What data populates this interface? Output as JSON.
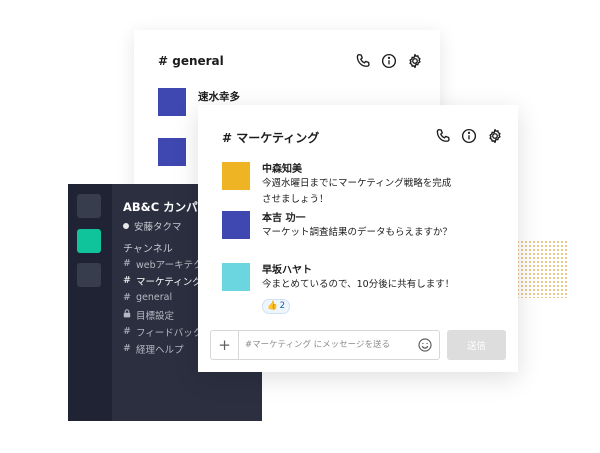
{
  "colors": {
    "sidebar_bg": "#2b2f3f",
    "rail_bg": "#1f2333",
    "active_workspace": "#0fc49b",
    "avatar_blue": "#3f47b0",
    "avatar_yellow": "#efb424",
    "avatar_cyan": "#6cd6e0",
    "send_button_disabled": "#dddddd"
  },
  "general_window": {
    "channel_title": "# general",
    "header_icons": [
      "phone-icon",
      "info-icon",
      "gear-icon"
    ],
    "messages": [
      {
        "author": "速水幸多"
      }
    ]
  },
  "sidebar": {
    "workspace_name": "AB&C カンパニー",
    "user_name": "安藤タクマ",
    "section_label": "チャンネル",
    "channels": [
      {
        "prefix": "#",
        "label": "webアーキテクチャ"
      },
      {
        "prefix": "#",
        "label": "マーケティング"
      },
      {
        "prefix": "#",
        "label": "general"
      },
      {
        "prefix": "lock",
        "label": "目標設定"
      },
      {
        "prefix": "#",
        "label": "フィードバック"
      },
      {
        "prefix": "#",
        "label": "経理ヘルプ"
      }
    ],
    "active_channel": "マーケティング"
  },
  "marketing_window": {
    "channel_title": "# マーケティング",
    "header_icons": [
      "phone-icon",
      "info-icon",
      "gear-icon"
    ],
    "messages": [
      {
        "author": "中森知美",
        "line1": "今週水曜日までにマーケティング戦略を完成",
        "line2": "させましょう！"
      },
      {
        "author": "本吉 功一",
        "line1": "マーケット調査結果のデータもらえますか？"
      },
      {
        "author": "早坂ハヤト",
        "line1": "今まとめているので、10分後に共有します！",
        "reaction_emoji": "👍",
        "reaction_count": "2"
      }
    ],
    "composer": {
      "plus_label": "+",
      "placeholder": "#マーケティング にメッセージを送る",
      "send_label": "送信"
    }
  }
}
